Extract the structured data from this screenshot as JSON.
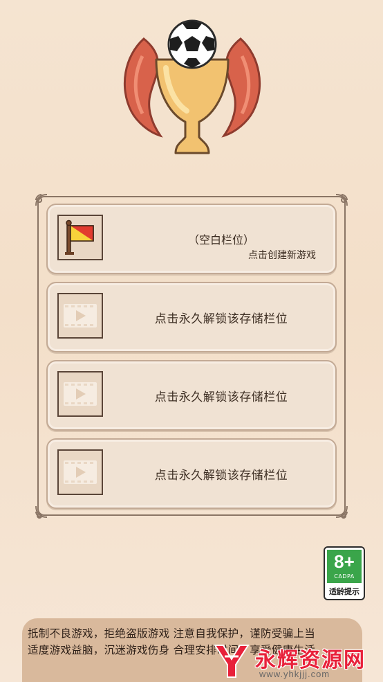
{
  "save_slots": [
    {
      "kind": "empty",
      "title": "（空白栏位）",
      "subtitle": "点击创建新游戏",
      "icon": "flag-icon"
    },
    {
      "kind": "locked",
      "label": "点击永久解锁该存储栏位",
      "icon": "video-play-icon"
    },
    {
      "kind": "locked",
      "label": "点击永久解锁该存储栏位",
      "icon": "video-play-icon"
    },
    {
      "kind": "locked",
      "label": "点击永久解锁该存储栏位",
      "icon": "video-play-icon"
    }
  ],
  "age_rating": {
    "value": "8+",
    "org": "CADPA",
    "label": "适龄提示"
  },
  "notice": {
    "line1": "抵制不良游戏，拒绝盗版游戏 注意自我保护，谨防受骗上当",
    "line2": "适度游戏益脑，沉迷游戏伤身 合理安排时间，享受健康生活"
  },
  "watermark": {
    "title": "永辉资源网",
    "url": "www.yhkjjj.com"
  },
  "colors": {
    "background": "#f5e4d1",
    "slot_border": "#c3aa95",
    "notice_bg": "#d9b99c",
    "rating_green": "#3aa54a",
    "watermark_red": "#e8213a"
  }
}
